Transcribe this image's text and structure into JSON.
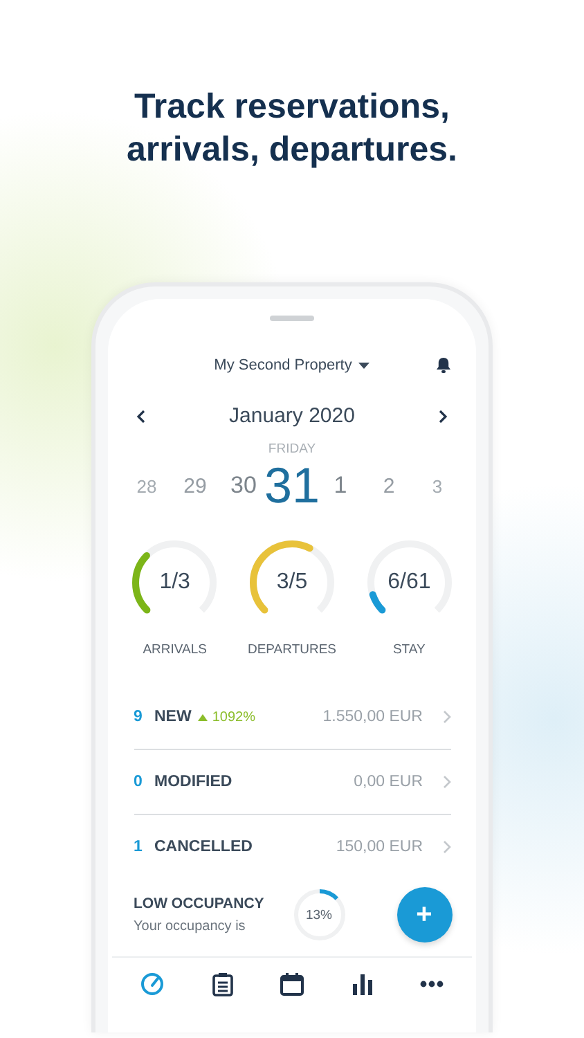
{
  "headline": "Track reservations,\narrivals, departures.",
  "header": {
    "property": "My Second Property"
  },
  "calendar": {
    "month": "January 2020",
    "weekday": "FRIDAY",
    "dates": [
      {
        "label": "28",
        "selected": false
      },
      {
        "label": "29",
        "selected": false
      },
      {
        "label": "30",
        "selected": false
      },
      {
        "label": "31",
        "selected": true
      },
      {
        "label": "1",
        "selected": false
      },
      {
        "label": "2",
        "selected": false
      },
      {
        "label": "3",
        "selected": false
      }
    ]
  },
  "gauges": [
    {
      "value": "1/3",
      "label": "ARRIVALS",
      "level": 0.33,
      "color": "#7cb518"
    },
    {
      "value": "3/5",
      "label": "DEPARTURES",
      "level": 0.6,
      "color": "#e8c23a"
    },
    {
      "value": "6/61",
      "label": "STAY",
      "level": 0.1,
      "color": "#1a9ad6"
    }
  ],
  "reservations": [
    {
      "count": "9",
      "label": "NEW",
      "change": "1092%",
      "amount": "1.550,00 EUR"
    },
    {
      "count": "0",
      "label": "MODIFIED",
      "amount": "0,00 EUR"
    },
    {
      "count": "1",
      "label": "CANCELLED",
      "amount": "150,00 EUR"
    }
  ],
  "occupancy": {
    "title": "LOW OCCUPANCY",
    "text": "Your occupancy is",
    "reading": "13%",
    "level": 0.13,
    "fab": "+"
  },
  "nav": {
    "items": [
      {
        "kind": "dashboard",
        "selected": true
      },
      {
        "kind": "list",
        "selected": false
      },
      {
        "kind": "calendar",
        "selected": false
      },
      {
        "kind": "stats",
        "selected": false
      },
      {
        "kind": "more",
        "selected": false
      }
    ]
  }
}
